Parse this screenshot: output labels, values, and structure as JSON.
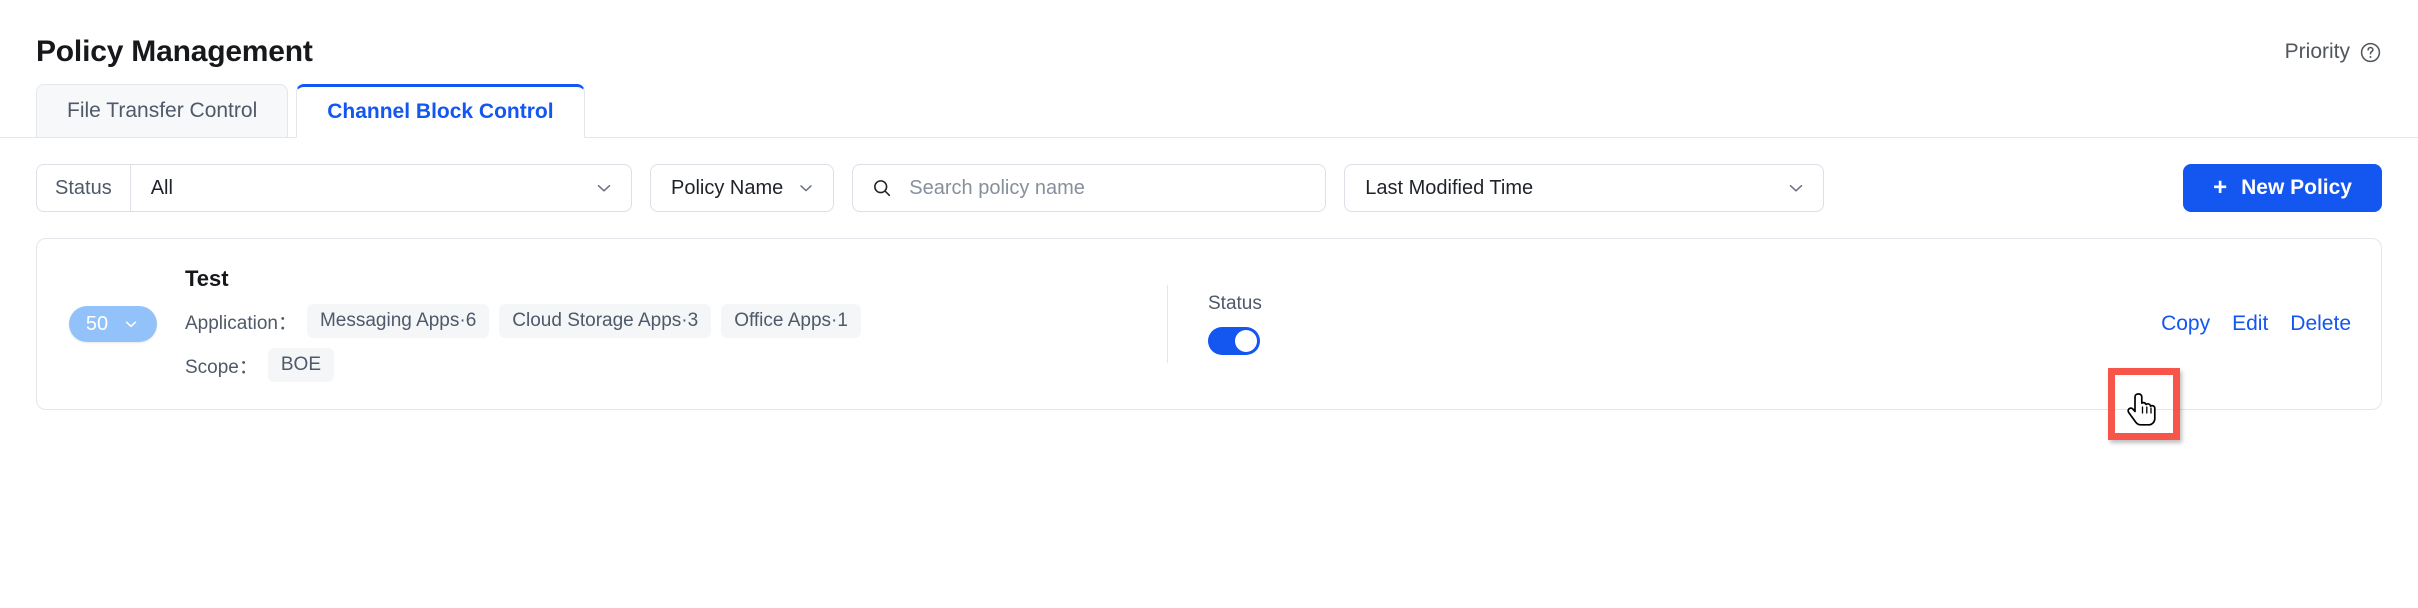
{
  "header": {
    "title": "Policy Management",
    "priority_label": "Priority",
    "help_icon": "question-circle-icon"
  },
  "tabs": [
    {
      "label": "File Transfer Control",
      "active": false
    },
    {
      "label": "Channel Block Control",
      "active": true
    }
  ],
  "filters": {
    "status": {
      "label": "Status",
      "value": "All",
      "chevron_icon": "chevron-down-icon"
    },
    "policy_name": {
      "label": "Policy Name",
      "chevron_icon": "chevron-down-icon"
    },
    "search": {
      "value": "",
      "placeholder": "Search policy name",
      "icon": "search-icon"
    },
    "sort": {
      "value": "Last Modified Time",
      "chevron_icon": "chevron-down-icon"
    },
    "new_policy": {
      "label": "New Policy",
      "icon": "plus-icon"
    }
  },
  "policy": {
    "priority": "50",
    "priority_chevron_icon": "chevron-down-icon",
    "name": "Test",
    "application_label": "Application：",
    "application_tags": [
      "Messaging Apps·6",
      "Cloud Storage Apps·3",
      "Office Apps·1"
    ],
    "scope_label": "Scope：",
    "scope_tags": [
      "BOE"
    ],
    "status_label": "Status",
    "status_on": true,
    "actions": [
      "Copy",
      "Edit",
      "Delete"
    ]
  },
  "annotation": {
    "target": "Copy",
    "box_color": "#f8554a",
    "cursor_icon": "pointing-hand-cursor"
  },
  "colors": {
    "accent": "#1456f0",
    "badge": "#93c2fa",
    "tag_bg": "#f5f6f8",
    "border": "#e5e6eb",
    "text": "#1f2329",
    "muted": "#4e5969",
    "placeholder": "#86909c"
  }
}
